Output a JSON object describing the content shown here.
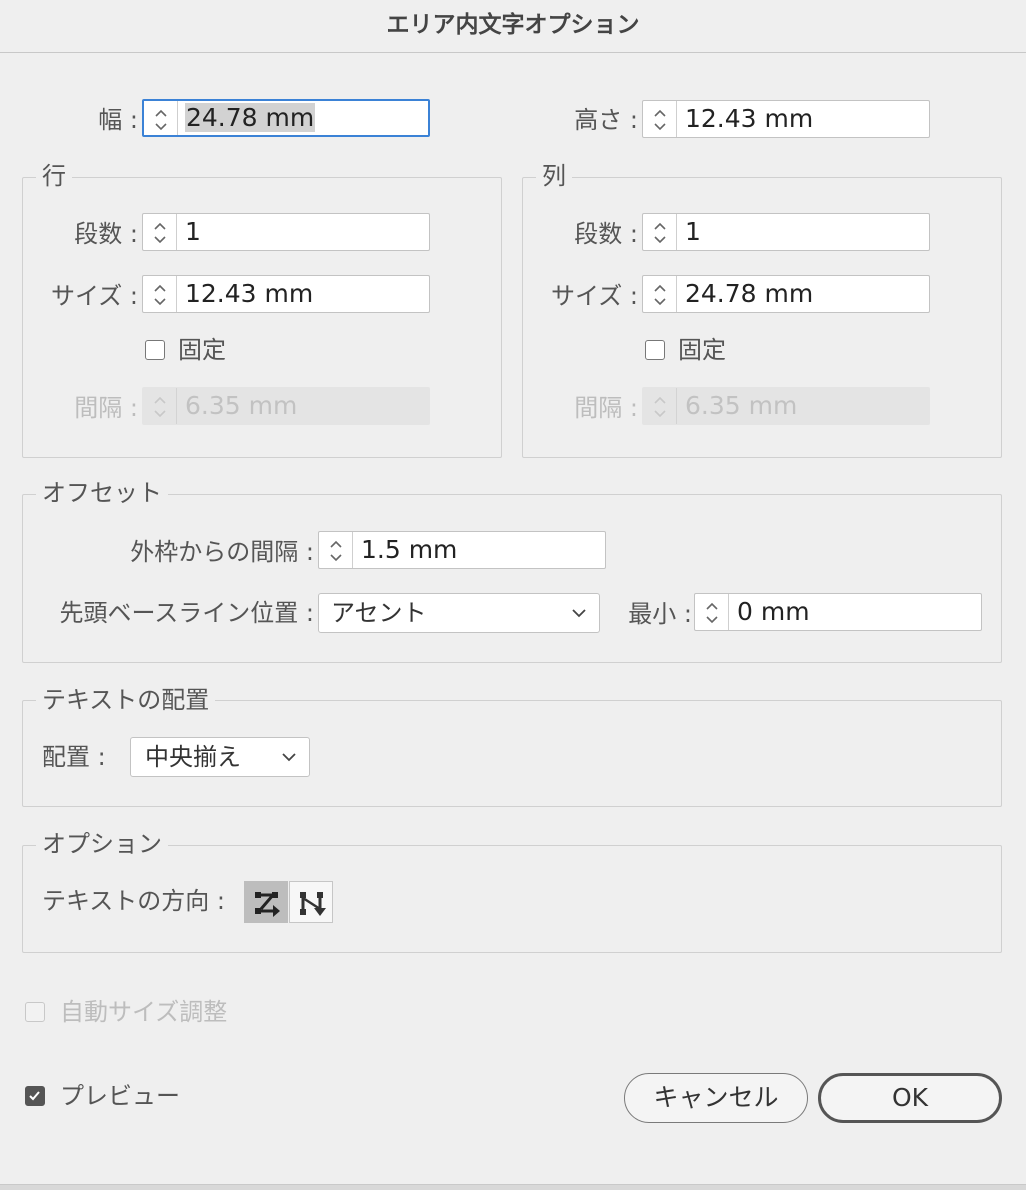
{
  "title": "エリア内文字オプション",
  "width": {
    "label": "幅 :",
    "value": "24.78 mm"
  },
  "height": {
    "label": "高さ :",
    "value": "12.43 mm"
  },
  "rows": {
    "title": "行",
    "count_label": "段数 :",
    "count_value": "1",
    "size_label": "サイズ :",
    "size_value": "12.43 mm",
    "fixed_label": "固定",
    "gutter_label": "間隔 :",
    "gutter_value": "6.35 mm"
  },
  "columns": {
    "title": "列",
    "count_label": "段数 :",
    "count_value": "1",
    "size_label": "サイズ :",
    "size_value": "24.78 mm",
    "fixed_label": "固定",
    "gutter_label": "間隔 :",
    "gutter_value": "6.35 mm"
  },
  "offset": {
    "title": "オフセット",
    "inset_label": "外枠からの間隔 :",
    "inset_value": "1.5 mm",
    "baseline_label": "先頭ベースライン位置 :",
    "baseline_value": "アセント",
    "min_label": "最小 :",
    "min_value": "0 mm"
  },
  "alignment": {
    "title": "テキストの配置",
    "align_label": "配置 :",
    "align_value": "中央揃え"
  },
  "options": {
    "title": "オプション",
    "flow_label": "テキストの方向 :",
    "flow_icons": [
      "text-flow-by-rows-icon",
      "text-flow-by-columns-icon"
    ]
  },
  "auto_size_label": "自動サイズ調整",
  "preview_label": "プレビュー",
  "preview_checked": true,
  "cancel_label": "キャンセル",
  "ok_label": "OK",
  "colors": {
    "focus": "#3b82d6",
    "dialog_bg": "#efefef"
  }
}
